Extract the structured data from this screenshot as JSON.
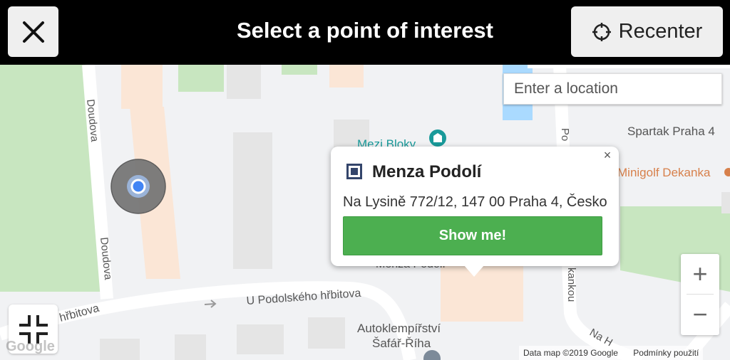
{
  "header": {
    "title": "Select a point of interest",
    "recenter_label": "Recenter"
  },
  "search": {
    "placeholder": "Enter a location"
  },
  "map": {
    "labels": {
      "doudova_top": "Doudova",
      "doudova_bottom": "Doudova",
      "u_podolskeho": "U Podolského hřbitova",
      "hrbitova": "hřbitova",
      "mezi_bloky": "Mezi Bloky",
      "spartak": "Spartak Praha 4",
      "minigolf": "Minigolf Dekanka",
      "auto_line1": "Autoklempířství",
      "auto_line2": "Šafář-Říha",
      "po_street": "Po",
      "kankou": "kankou",
      "na_h": "Na H",
      "menza_partial": "Menza Podolí"
    },
    "colors": {
      "background": "#f1f2f4",
      "park": "#c8e6c0",
      "building": "#e5e5e5",
      "building_peach": "#fbe6d6",
      "water": "#aadaff",
      "poi_teal": "#1a9a9a",
      "poi_orange": "#d7804b"
    }
  },
  "popup": {
    "name": "Menza Podolí",
    "address": "Na Lysině 772/12, 147 00 Praha 4, Česko",
    "button_label": "Show me!",
    "close_glyph": "×"
  },
  "zoom": {
    "in_glyph": "+",
    "out_glyph": "−"
  },
  "attribution": {
    "data": "Data map ©2019 Google",
    "terms": "Podmínky použití"
  },
  "google_logo": "Google"
}
